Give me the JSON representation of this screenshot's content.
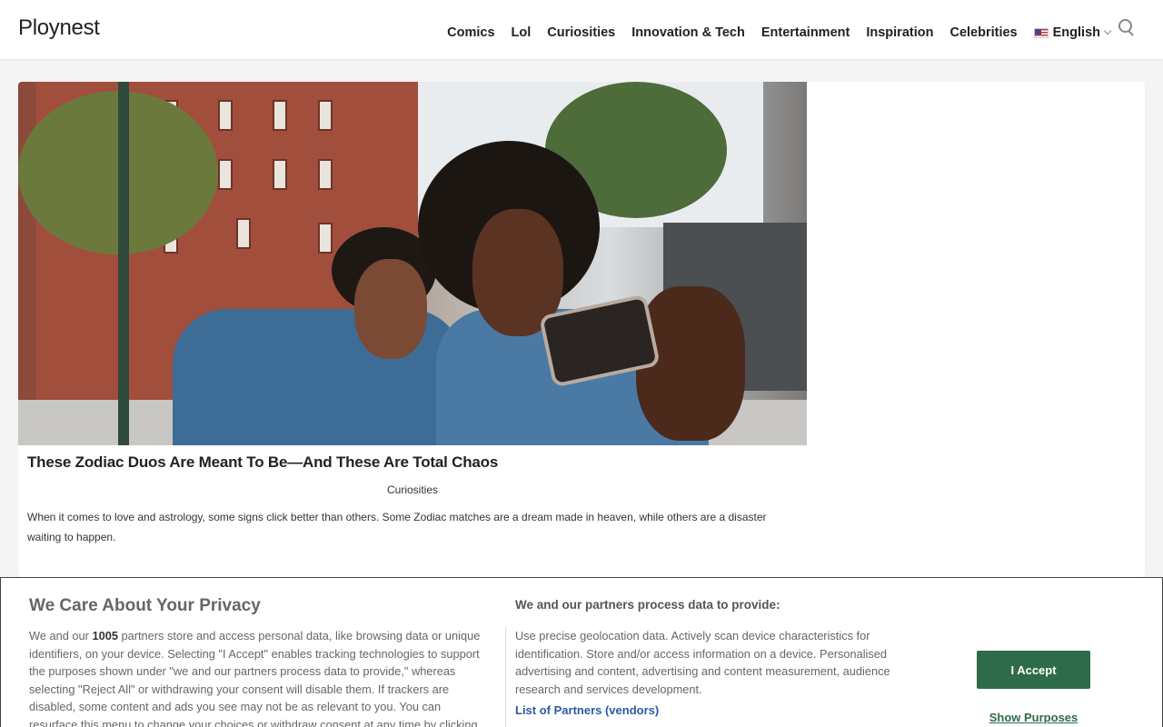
{
  "header": {
    "logo": "Ploynest",
    "nav": [
      "Comics",
      "Lol",
      "Curiosities",
      "Innovation & Tech",
      "Entertainment",
      "Inspiration",
      "Celebrities"
    ],
    "language": "English",
    "icons": {
      "flag": "us-flag-icon",
      "dropdown": "chevron-down-icon",
      "search": "search-icon"
    }
  },
  "article": {
    "title": "These Zodiac Duos Are Meant To Be—And These Are Total Chaos",
    "category": "Curiosities",
    "excerpt": "When it comes to love and astrology, some signs click better than others. Some Zodiac matches are a dream made in heaven, while others are a disaster waiting to happen."
  },
  "consent": {
    "heading": "We Care About Your Privacy",
    "left_prefix": "We and our ",
    "partner_count": "1005",
    "left_suffix": " partners store and access personal data, like browsing data or unique identifiers, on your device. Selecting \"I Accept\" enables tracking technologies to support the purposes shown under \"we and our partners process data to provide,\" whereas selecting \"Reject All\" or withdrawing your consent will disable them. If trackers are disabled, some content and ads you see may not be as relevant to you. You can resurface this menu to change your choices or withdraw consent at any time by clicking",
    "right_heading": "We and our partners process data to provide:",
    "right_text": "Use precise geolocation data. Actively scan device characteristics for identification. Store and/or access information on a device. Personalised advertising and content, advertising and content measurement, audience research and services development.",
    "partners_link": "List of Partners (vendors)",
    "accept_label": "I Accept",
    "purposes_label": "Show Purposes"
  },
  "colors": {
    "accent_green": "#2e6b4a",
    "link_blue": "#2d5aa0"
  }
}
